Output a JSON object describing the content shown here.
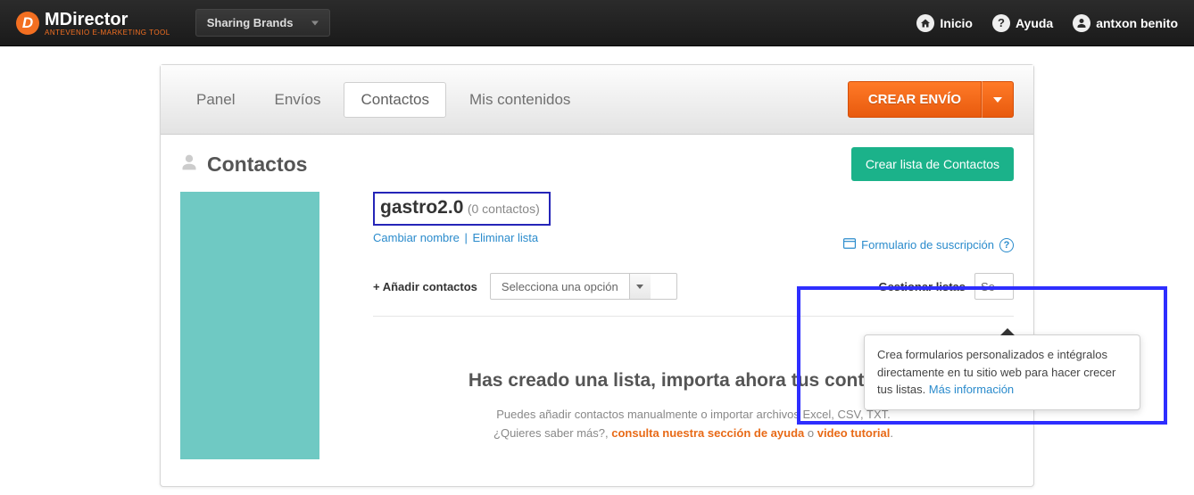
{
  "topbar": {
    "logo_text": "MDirector",
    "logo_tagline": "ANTEVENIO E-MARKETING TOOL",
    "brand_dropdown": "Sharing Brands",
    "links": {
      "home": "Inicio",
      "help": "Ayuda",
      "user": "antxon benito"
    }
  },
  "tabs": {
    "panel": "Panel",
    "envios": "Envíos",
    "contactos": "Contactos",
    "mis": "Mis contenidos"
  },
  "create_send": "CREAR ENVÍO",
  "page_title": "Contactos",
  "create_list_btn": "Crear lista de Contactos",
  "list": {
    "name": "gastro2.0",
    "count_text": "(0 contactos)",
    "rename": "Cambiar nombre",
    "delete": "Eliminar lista"
  },
  "form_link": "Formulario de suscripción",
  "row": {
    "add_label": "+ Añadir contactos",
    "add_select": "Selecciona una opción",
    "manage_label": "Gestionar listas",
    "manage_select_prefix": "Se"
  },
  "tooltip": {
    "text": "Crea formularios personalizados e intégralos directamente en tu sitio web para hacer crecer tus listas. ",
    "link": "Más información"
  },
  "empty": {
    "title": "Has creado una lista, importa ahora tus contactos.",
    "line1": "Puedes añadir contactos manualmente o importar archivos Excel, CSV, TXT.",
    "line2a": "¿Quieres saber más?, ",
    "link1": "consulta nuestra sección de ayuda",
    "line2b": " o ",
    "link2": "video tutorial",
    "dot": "."
  }
}
